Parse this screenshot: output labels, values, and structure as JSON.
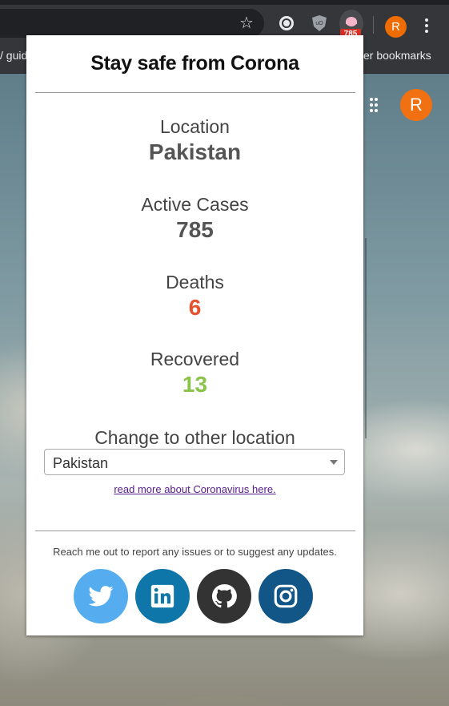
{
  "browser": {
    "bookmarks_left": "/ guid",
    "bookmarks_right": "er bookmarks",
    "extension_badge": "785",
    "profile_initial": "R"
  },
  "page": {
    "avatar_initial": "R"
  },
  "popup": {
    "title": "Stay safe from Corona",
    "location_label": "Location",
    "location_value": "Pakistan",
    "active_label": "Active Cases",
    "active_value": "785",
    "deaths_label": "Deaths",
    "deaths_value": "6",
    "recovered_label": "Recovered",
    "recovered_value": "13",
    "change_label": "Change to other location",
    "select_value": "Pakistan",
    "read_more": "read more about Coronavirus here.",
    "report_text": "Reach me out to report any issues or to suggest any updates."
  },
  "colors": {
    "deaths": "#e8512e",
    "recovered": "#8bc34a",
    "twitter": "#55acee",
    "linkedin": "#0e76a8",
    "github": "#333333",
    "instagram": "#125688",
    "avatar": "#ef6c00"
  },
  "social_icons": [
    "twitter-icon",
    "linkedin-icon",
    "github-icon",
    "instagram-icon"
  ]
}
